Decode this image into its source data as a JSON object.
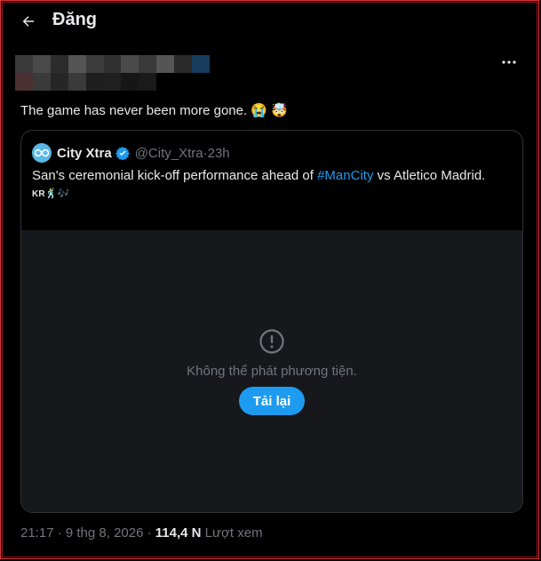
{
  "header": {
    "title": "Đăng",
    "back_icon": "arrow-left-icon"
  },
  "post": {
    "text": "The game has never been more gone.",
    "emoji": "😭 🤯",
    "more_icon": "more-horizontal-icon",
    "timestamp": "21:17 · 9 thg 8, 2026 · ",
    "views_count": "114,4 N",
    "views_label": " Lượt xem"
  },
  "quote": {
    "name": "City Xtra",
    "handle": "@City_Xtra",
    "separator": " · ",
    "time": "23h",
    "text_before": "San's ceremonial kick-off performance ahead of ",
    "hashtag": "#ManCity",
    "text_after": " vs Atletico Madrid.",
    "emoji_prefix": "KR",
    "emoji_rest": "🕺🎶",
    "media": {
      "error_message": "Không thể phát phương tiện.",
      "retry_label": "Tải lại",
      "error_icon": "alert-circle-icon"
    }
  },
  "colors": {
    "accent": "#1d9bf0",
    "background": "#000000",
    "muted": "#71767b",
    "media_bg": "#16181c",
    "border": "#2f3336"
  }
}
